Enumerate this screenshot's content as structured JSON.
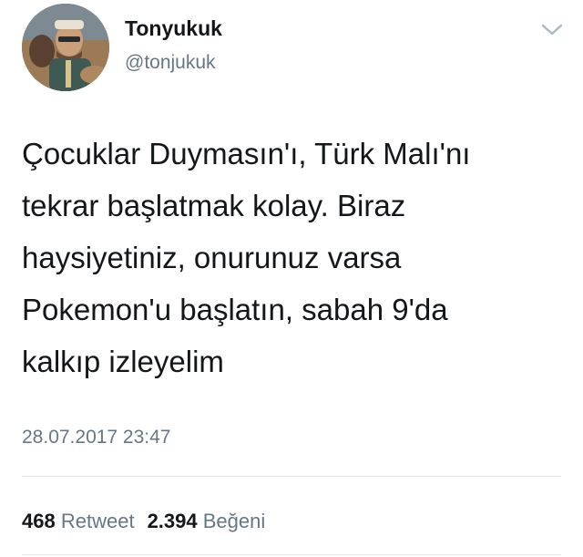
{
  "user": {
    "display_name": "Tonyukuk",
    "handle": "@tonjukuk"
  },
  "icons": {
    "menu": "chevron-down-icon",
    "avatar": "avatar"
  },
  "tweet": {
    "text": "Çocuklar Duymasın'ı, Türk Malı'nı\ntekrar başlatmak kolay. Biraz\nhaysiyetiniz, onurunuz varsa\nPokemon'u başlatın, sabah 9'da\nkalkıp izleyelim",
    "timestamp": "28.07.2017 23:47"
  },
  "stats": {
    "retweets": {
      "count": "468",
      "label": "Retweet"
    },
    "likes": {
      "count": "2.394",
      "label": "Beğeni"
    }
  },
  "colors": {
    "text": "#14171a",
    "secondary": "#657786",
    "divider": "#e1e8ed"
  }
}
